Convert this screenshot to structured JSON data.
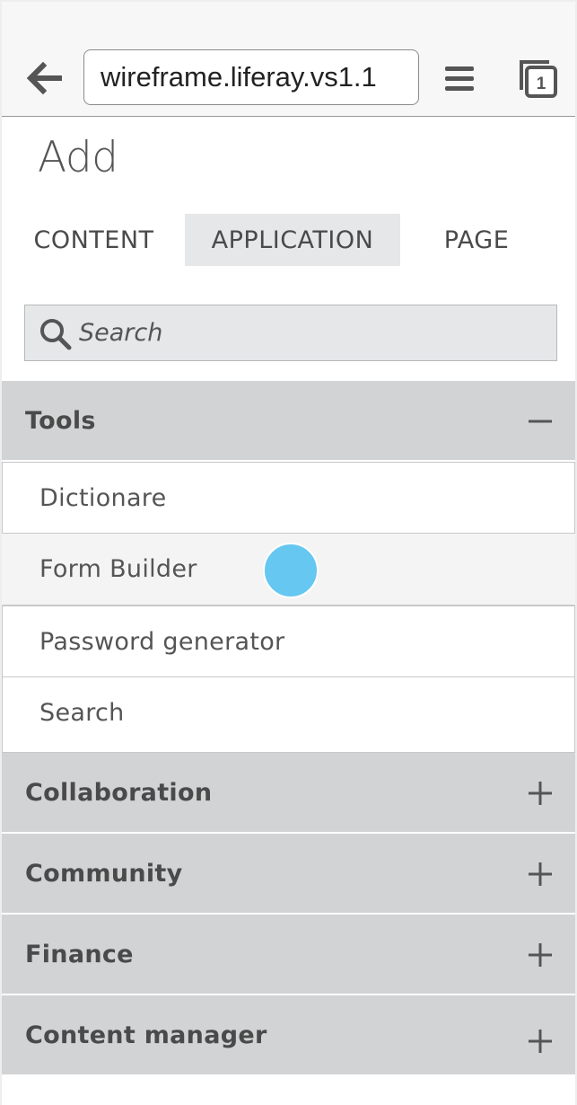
{
  "browser": {
    "url": "wireframe.liferay.vs1.1",
    "tab_count": "1",
    "back_icon": "arrow-left-icon",
    "menu_icon": "hamburger-icon",
    "tabs_icon": "tabs-icon"
  },
  "panel": {
    "title": "Add",
    "tabs": [
      {
        "label": "CONTENT",
        "active": false
      },
      {
        "label": "APPLICATION",
        "active": true
      },
      {
        "label": "PAGE",
        "active": false
      }
    ],
    "search": {
      "placeholder": "Search",
      "value": ""
    }
  },
  "sections": [
    {
      "label": "Tools",
      "expanded": true,
      "toggle_icon": "minus-icon",
      "items": [
        {
          "label": "Dictionare"
        },
        {
          "label": "Form Builder"
        },
        {
          "label": "Password generator"
        },
        {
          "label": "Search"
        }
      ]
    },
    {
      "label": "Collaboration",
      "expanded": false,
      "toggle_icon": "plus-icon"
    },
    {
      "label": "Community",
      "expanded": false,
      "toggle_icon": "plus-icon"
    },
    {
      "label": "Finance",
      "expanded": false,
      "toggle_icon": "plus-icon"
    },
    {
      "label": "Content manager",
      "expanded": false,
      "toggle_icon": "plus-icon"
    }
  ],
  "colors": {
    "section_header_bg": "#d2d3d5",
    "active_tab_bg": "#e6e7e9",
    "tap_indicator": "#66c7f0",
    "text": "#555555"
  }
}
